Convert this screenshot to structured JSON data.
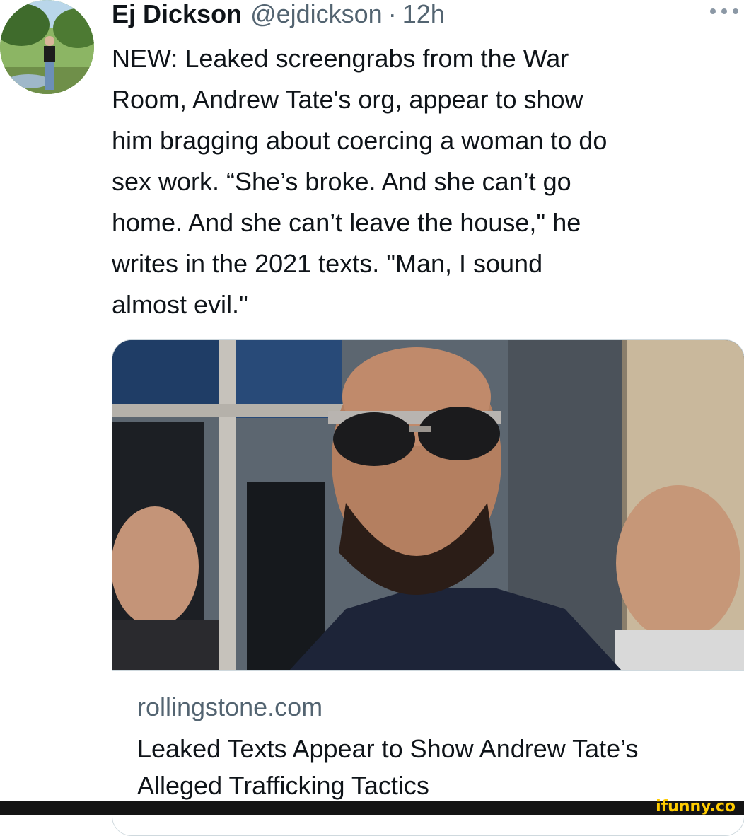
{
  "tweet": {
    "author_name": "Ej Dickson",
    "author_handle": "@ejdickson",
    "separator": "·",
    "time": "12h",
    "text": "NEW: Leaked screengrabs from the War\nRoom, Andrew Tate's org, appear to show\nhim bragging about coercing a woman to do\nsex work. “She’s broke. And she can’t go\nhome. And she can’t leave the house,\" he\nwrites in the 2021 texts. \"Man, I sound\nalmost evil.\""
  },
  "link_card": {
    "domain": "rollingstone.com",
    "title": "Leaked Texts Appear to Show Andrew Tate’s Alleged Trafficking Tactics"
  },
  "watermark": {
    "text": "ifunny.co"
  },
  "icons": {
    "more": "more-horizontal-icon",
    "avatar": "profile-photo"
  },
  "colors": {
    "text_primary": "#0f1419",
    "text_secondary": "#536471",
    "border": "#cfd9de",
    "watermark": "#ffcc00"
  }
}
